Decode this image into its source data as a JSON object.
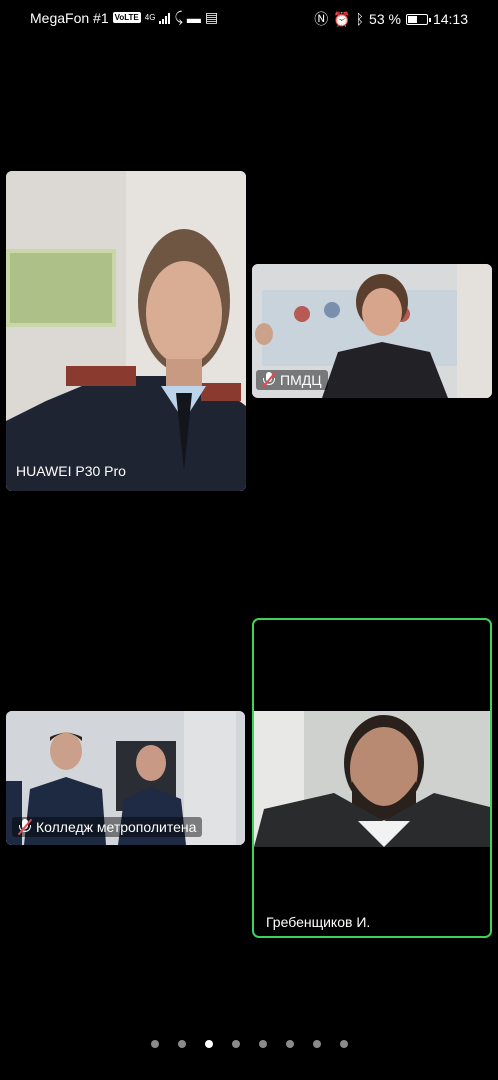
{
  "status_bar": {
    "carrier": "MegaFon #1",
    "volte": "VoLTE",
    "network": "4G",
    "battery_percent": "53 %",
    "battery_level": 0.53,
    "time": "14:13"
  },
  "participants": [
    {
      "name": "HUAWEI P30 Pro",
      "muted": false,
      "active_speaker": false
    },
    {
      "name": "ПМДЦ",
      "muted": true,
      "active_speaker": false
    },
    {
      "name": "Колледж метрополитена",
      "muted": true,
      "active_speaker": false
    },
    {
      "name": "Гребенщиков И.",
      "muted": false,
      "active_speaker": true
    }
  ],
  "pagination": {
    "pages": 8,
    "current": 3
  },
  "colors": {
    "active_border": "#3fd25a",
    "muted_slash": "#e5484d"
  }
}
